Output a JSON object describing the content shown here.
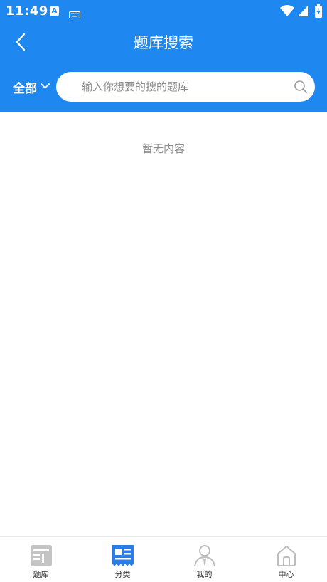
{
  "status_bar": {
    "time": "11:49",
    "a_icon_letter": "A"
  },
  "nav": {
    "title": "题库搜索"
  },
  "search": {
    "category_label": "全部",
    "placeholder": "输入你想要的搜的题库"
  },
  "content": {
    "empty_message": "暂无内容"
  },
  "tabs": [
    {
      "label": "题库",
      "icon": "question-bank-icon",
      "active": false
    },
    {
      "label": "分类",
      "icon": "category-icon",
      "active": true
    },
    {
      "label": "我的",
      "icon": "profile-icon",
      "active": false
    },
    {
      "label": "中心",
      "icon": "home-icon",
      "active": false
    }
  ],
  "colors": {
    "brand": "#1e88f0",
    "tab_inactive_icon": "#bdbdbd",
    "tab_active_icon": "#2a7de6"
  }
}
